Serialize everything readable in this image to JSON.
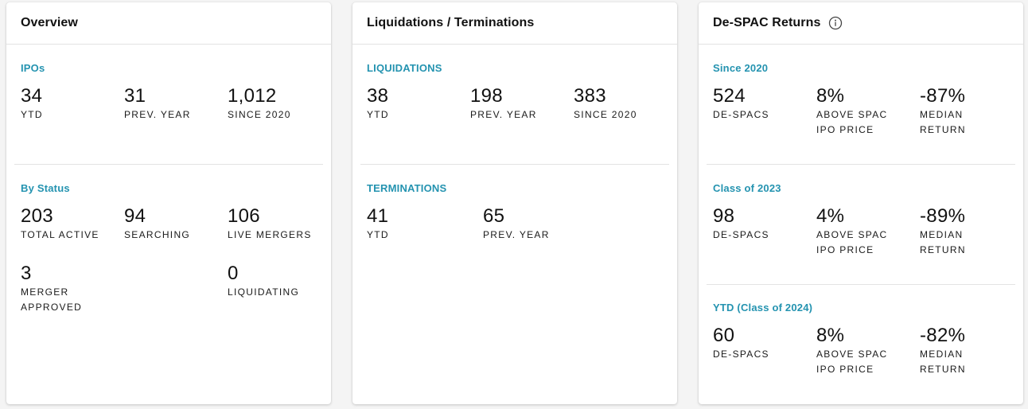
{
  "overview": {
    "title": "Overview",
    "ipos": {
      "label": "IPOs",
      "stats": [
        {
          "value": "34",
          "caption": "YTD"
        },
        {
          "value": "31",
          "caption": "PREV. YEAR"
        },
        {
          "value": "1,012",
          "caption": "SINCE 2020"
        }
      ]
    },
    "by_status": {
      "label": "By Status",
      "stats": [
        {
          "value": "203",
          "caption": "TOTAL ACTIVE"
        },
        {
          "value": "94",
          "caption": "SEARCHING"
        },
        {
          "value": "106",
          "caption": "LIVE MERGERS"
        },
        {
          "value": "3",
          "caption": "MERGER APPROVED"
        },
        {
          "value": "0",
          "caption": "LIQUIDATING"
        }
      ]
    }
  },
  "liquidations": {
    "title": "Liquidations / Terminations",
    "liquidations": {
      "label": "LIQUIDATIONS",
      "stats": [
        {
          "value": "38",
          "caption": "YTD"
        },
        {
          "value": "198",
          "caption": "PREV. YEAR"
        },
        {
          "value": "383",
          "caption": "SINCE 2020"
        }
      ]
    },
    "terminations": {
      "label": "TERMINATIONS",
      "stats": [
        {
          "value": "41",
          "caption": "YTD"
        },
        {
          "value": "65",
          "caption": "PREV. YEAR"
        }
      ]
    }
  },
  "despac": {
    "title": "De-SPAC Returns",
    "info_icon": "info-circle-icon",
    "groups": [
      {
        "label": "Since 2020",
        "stats": [
          {
            "value": "524",
            "caption": "DE-SPACS"
          },
          {
            "value": "8%",
            "caption": "ABOVE SPAC IPO PRICE"
          },
          {
            "value": "-87%",
            "caption": "MEDIAN RETURN"
          }
        ]
      },
      {
        "label": "Class of 2023",
        "stats": [
          {
            "value": "98",
            "caption": "DE-SPACS"
          },
          {
            "value": "4%",
            "caption": "ABOVE SPAC IPO PRICE"
          },
          {
            "value": "-89%",
            "caption": "MEDIAN RETURN"
          }
        ]
      },
      {
        "label": "YTD (Class of 2024)",
        "stats": [
          {
            "value": "60",
            "caption": "DE-SPACS"
          },
          {
            "value": "8%",
            "caption": "ABOVE SPAC IPO PRICE"
          },
          {
            "value": "-82%",
            "caption": "MEDIAN RETURN"
          }
        ]
      }
    ]
  },
  "colors": {
    "accent": "#2493b0",
    "card_bg": "#ffffff",
    "page_bg": "#f4f4f4",
    "divider": "#e3e3e3"
  }
}
